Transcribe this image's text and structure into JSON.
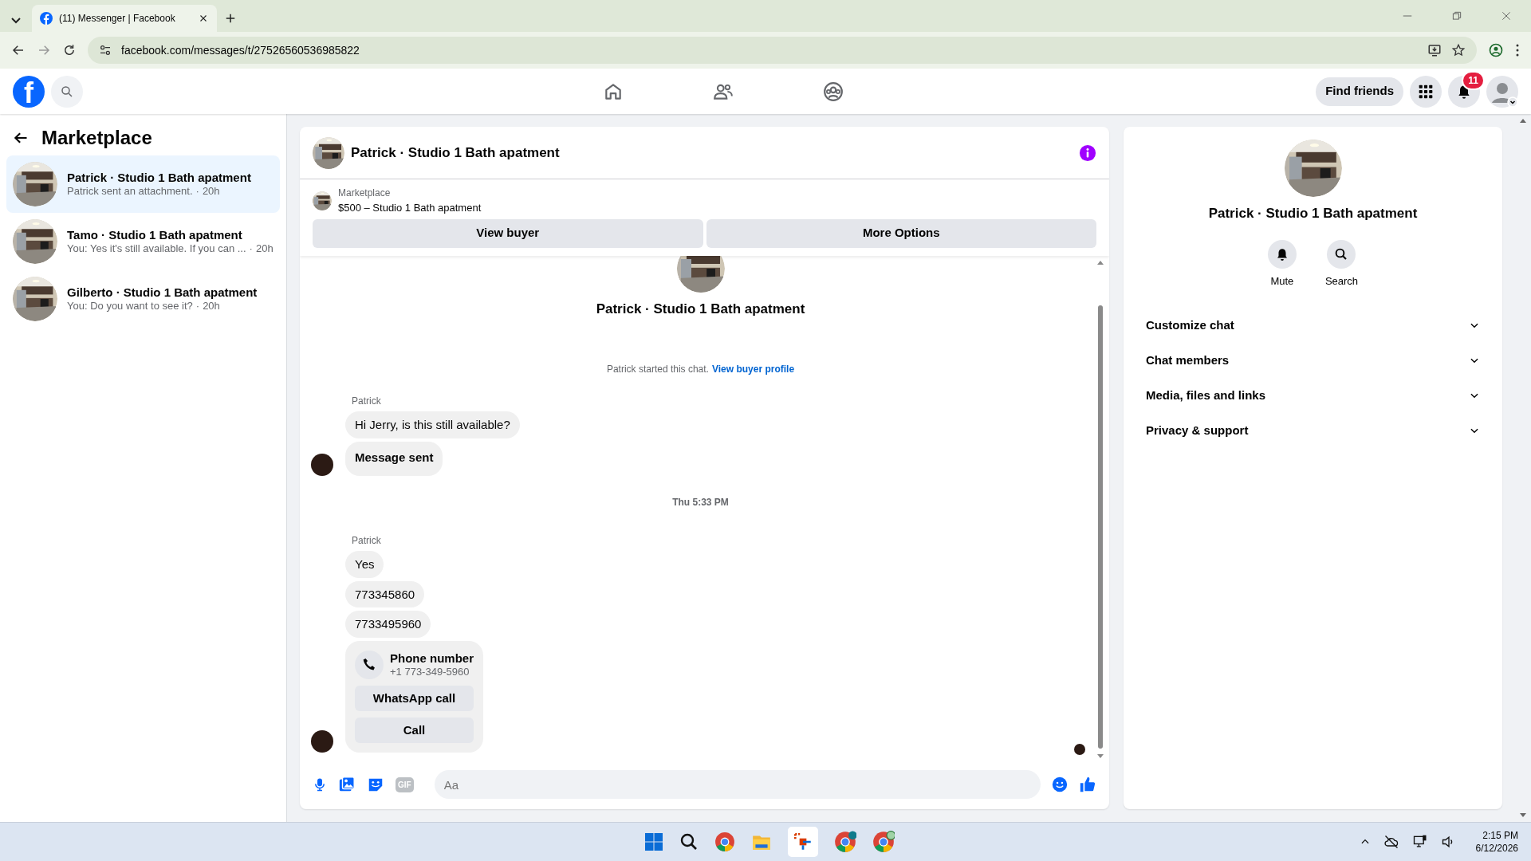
{
  "browser": {
    "tab_title": "(11) Messenger | Facebook",
    "url": "facebook.com/messages/t/27526560536985822"
  },
  "header": {
    "logo_text": "f",
    "find_friends": "Find friends",
    "notification_count": "11"
  },
  "sidebar": {
    "title": "Marketplace",
    "separator": "·",
    "conversations": [
      {
        "name": "Patrick · Studio 1 Bath apatment",
        "preview": "Patrick sent an attachment.",
        "time": "20h",
        "selected": true
      },
      {
        "name": "Tamo · Studio 1 Bath apatment",
        "preview": "You: Yes it's still available. If you can ...",
        "time": "20h",
        "selected": false
      },
      {
        "name": "Gilberto · Studio 1 Bath apatment",
        "preview": "You: Do you want to see it?",
        "time": "20h",
        "selected": false
      }
    ]
  },
  "chat": {
    "title": "Patrick · Studio 1 Bath apatment",
    "listing": {
      "label": "Marketplace",
      "item": "$500 – Studio 1 Bath apatment"
    },
    "buttons": [
      "View buyer",
      "More Options"
    ],
    "intro_name": "Patrick · Studio 1 Bath apatment",
    "started_text": "Patrick started this chat.",
    "started_link": "View buyer profile",
    "groups": [
      {
        "sender": "Patrick",
        "messages": [
          {
            "kind": "text",
            "text": "Hi Jerry, is this still available?"
          },
          {
            "kind": "bold",
            "text": "Message sent"
          }
        ]
      },
      {
        "timestamp": "Thu 5:33 PM",
        "sender": "Patrick",
        "messages": [
          {
            "kind": "text",
            "text": "Yes"
          },
          {
            "kind": "text",
            "text": "773345860"
          },
          {
            "kind": "text",
            "text": "7733495960"
          },
          {
            "kind": "contact",
            "title": "Phone number",
            "number": "+1 773-349-5960",
            "actions": [
              "WhatsApp call",
              "Call"
            ]
          }
        ]
      }
    ],
    "composer": {
      "gif_label": "GIF",
      "placeholder": "Aa"
    }
  },
  "details": {
    "name": "Patrick · Studio 1 Bath apatment",
    "actions": [
      {
        "kind": "mute",
        "label": "Mute"
      },
      {
        "kind": "search",
        "label": "Search"
      }
    ],
    "sections": [
      {
        "label": "Customize chat",
        "expanded": false
      },
      {
        "label": "Chat members",
        "expanded": false
      },
      {
        "label": "Media, files and links",
        "expanded": false
      },
      {
        "label": "Privacy & support",
        "expanded": false
      }
    ]
  },
  "taskbar": {
    "time": "2:15 PM",
    "date": "6/12/2026"
  }
}
